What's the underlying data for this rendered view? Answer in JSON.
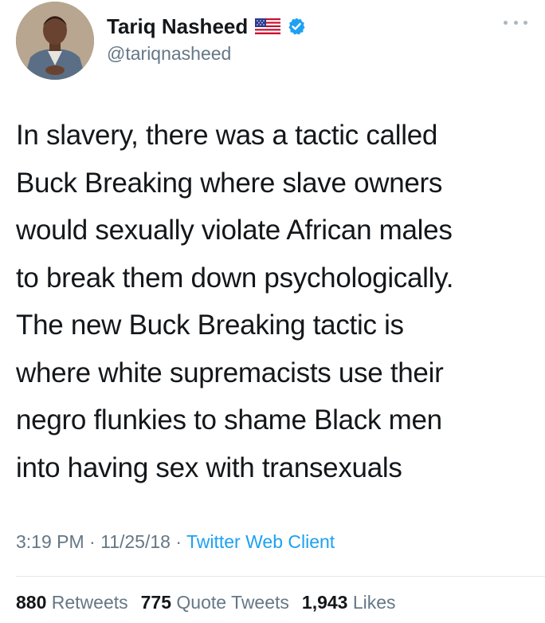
{
  "tweet": {
    "author": {
      "display_name": "Tariq Nasheed",
      "handle": "@tariqnasheed",
      "verified": true,
      "flag_emoji": "us-flag-icon"
    },
    "text": "In slavery, there was a tactic called\nBuck Breaking where slave owners\nwould sexually violate African males\nto break them down psychologically.\nThe new Buck Breaking tactic is\nwhere white supremacists use their\nnegro flunkies to shame Black men\ninto having sex with transexuals",
    "time": "3:19 PM",
    "date": "11/25/18",
    "separator": "·",
    "client": "Twitter Web Client",
    "stats": {
      "retweets_count": "880",
      "retweets_label": "Retweets",
      "quote_count": "775",
      "quote_label": "Quote Tweets",
      "likes_count": "1,943",
      "likes_label": "Likes"
    }
  },
  "colors": {
    "text_primary": "#14171a",
    "text_secondary": "#657786",
    "link": "#1da1f2",
    "verified": "#1da1f2",
    "divider": "#e1e8ed"
  }
}
